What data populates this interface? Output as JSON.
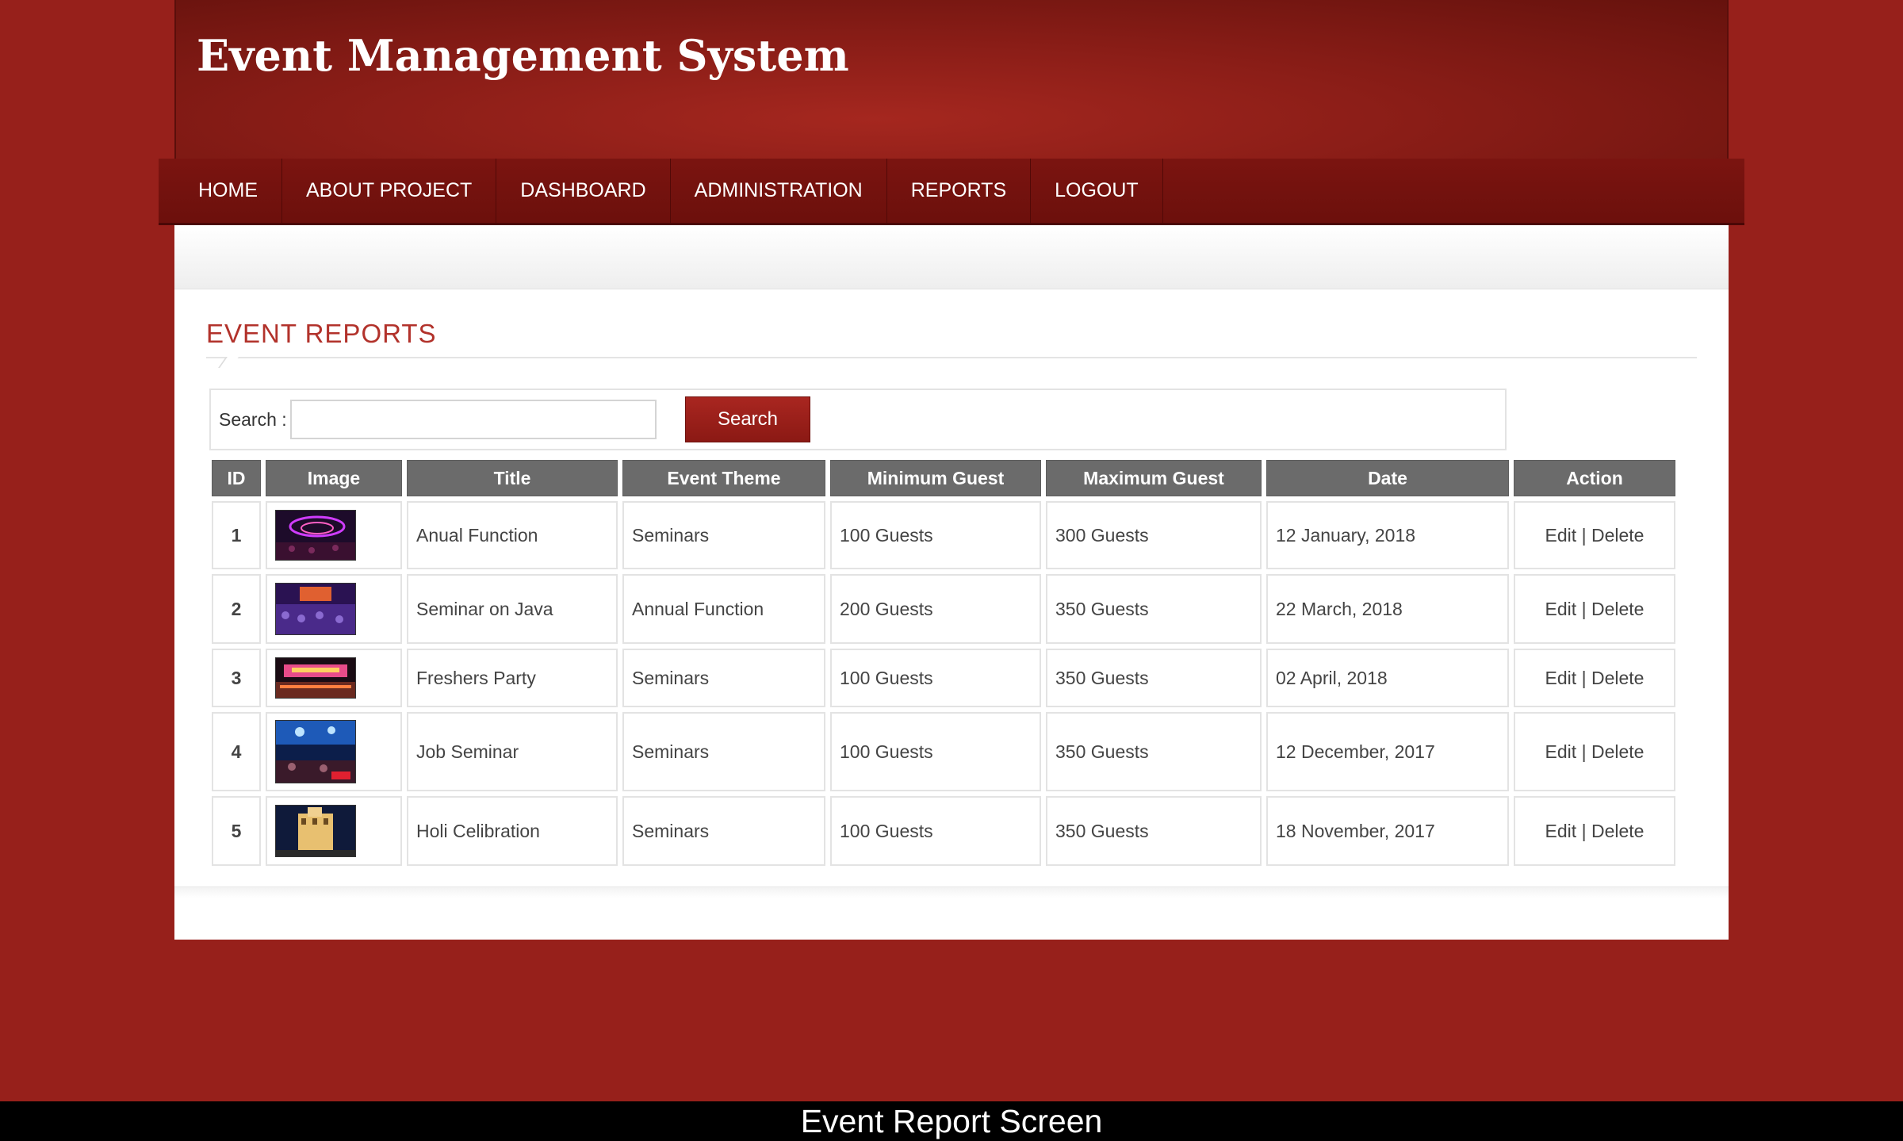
{
  "site": {
    "title": "Event Management System"
  },
  "nav": {
    "items": [
      {
        "label": "HOME"
      },
      {
        "label": "ABOUT PROJECT"
      },
      {
        "label": "DASHBOARD"
      },
      {
        "label": "ADMINISTRATION"
      },
      {
        "label": "REPORTS"
      },
      {
        "label": "LOGOUT"
      }
    ]
  },
  "page": {
    "title": "EVENT REPORTS"
  },
  "search": {
    "label": "Search :",
    "value": "",
    "placeholder": "",
    "button_label": "Search"
  },
  "table": {
    "columns": [
      "ID",
      "Image",
      "Title",
      "Event Theme",
      "Minimum Guest",
      "Maximum Guest",
      "Date",
      "Action"
    ],
    "rows": [
      {
        "id": "1",
        "image": "concert-stage-purple-lights",
        "title": "Anual Function",
        "theme": "Seminars",
        "min": "100 Guests",
        "max": "300 Guests",
        "date": "12 January, 2018",
        "edit": "Edit",
        "sep": "|",
        "delete": "Delete"
      },
      {
        "id": "2",
        "image": "crowd-hall-purple",
        "title": "Seminar on Java",
        "theme": "Annual Function",
        "min": "200 Guests",
        "max": "350 Guests",
        "date": "22 March, 2018",
        "edit": "Edit",
        "sep": "|",
        "delete": "Delete"
      },
      {
        "id": "3",
        "image": "stage-pink-banner",
        "title": "Freshers Party",
        "theme": "Seminars",
        "min": "100 Guests",
        "max": "350 Guests",
        "date": "02 April, 2018",
        "edit": "Edit",
        "sep": "|",
        "delete": "Delete"
      },
      {
        "id": "4",
        "image": "blue-concert-lights",
        "title": "Job Seminar",
        "theme": "Seminars",
        "min": "100 Guests",
        "max": "350 Guests",
        "date": "12 December, 2017",
        "edit": "Edit",
        "sep": "|",
        "delete": "Delete"
      },
      {
        "id": "5",
        "image": "lit-building-night",
        "title": "Holi Celibration",
        "theme": "Seminars",
        "min": "100 Guests",
        "max": "350 Guests",
        "date": "18 November, 2017",
        "edit": "Edit",
        "sep": "|",
        "delete": "Delete"
      }
    ]
  },
  "caption": "Event Report Screen",
  "colors": {
    "background": "#97201b",
    "nav": "#6c100c",
    "accent_title": "#b2322b",
    "header_cell": "#6b6b6b",
    "button": "#9a1f19"
  }
}
